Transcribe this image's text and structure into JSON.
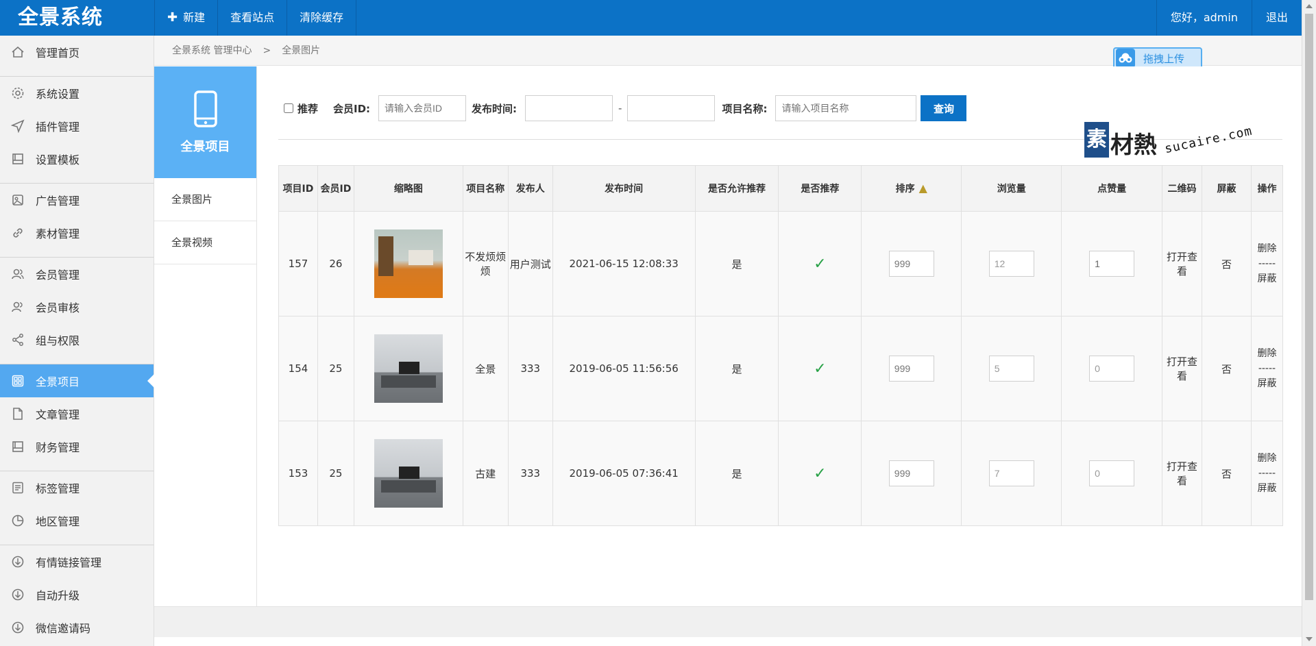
{
  "app": {
    "brand": "全景系统"
  },
  "topnav": {
    "new_label": "新建",
    "view_site_label": "查看站点",
    "clear_cache_label": "清除缓存"
  },
  "user": {
    "greeting": "您好，admin",
    "logout_label": "退出"
  },
  "sidebar": {
    "items": [
      {
        "label": "管理首页",
        "icon": "home-icon"
      },
      {
        "label": "系统设置",
        "icon": "gear-icon"
      },
      {
        "label": "插件管理",
        "icon": "send-icon"
      },
      {
        "label": "设置模板",
        "icon": "template-icon"
      },
      {
        "label": "广告管理",
        "icon": "image-icon"
      },
      {
        "label": "素材管理",
        "icon": "link-icon"
      },
      {
        "label": "会员管理",
        "icon": "users-icon"
      },
      {
        "label": "会员审核",
        "icon": "user-check-icon"
      },
      {
        "label": "组与权限",
        "icon": "share-icon"
      },
      {
        "label": "全景项目",
        "icon": "grid-icon"
      },
      {
        "label": "文章管理",
        "icon": "file-icon"
      },
      {
        "label": "财务管理",
        "icon": "book-icon"
      },
      {
        "label": "标签管理",
        "icon": "list-icon"
      },
      {
        "label": "地区管理",
        "icon": "pie-icon"
      },
      {
        "label": "有情链接管理",
        "icon": "download-circle-icon"
      },
      {
        "label": "自动升级",
        "icon": "download-circle-icon"
      },
      {
        "label": "微信邀请码",
        "icon": "download-circle-icon"
      }
    ]
  },
  "breadcrumb": {
    "root": "全景系统 管理中心",
    "separator": ">",
    "current": "全景图片"
  },
  "upload": {
    "label": "拖拽上传"
  },
  "subnav": {
    "title": "全景项目",
    "items": [
      "全景图片",
      "全景视频"
    ]
  },
  "filters": {
    "recommend_label": "推荐",
    "member_id_label": "会员ID:",
    "member_id_placeholder": "请输入会员ID",
    "publish_time_label": "发布时间:",
    "range_separator": "-",
    "project_name_label": "项目名称:",
    "project_name_placeholder": "请输入项目名称",
    "query_label": "查询"
  },
  "watermark": {
    "logo_char": "素",
    "text": "材熱",
    "url": "sucaire.com"
  },
  "table": {
    "headers": {
      "project_id": "项目ID",
      "member_id": "会员ID",
      "thumbnail": "缩略图",
      "project_name": "项目名称",
      "publisher": "发布人",
      "publish_time": "发布时间",
      "allow_recommend": "是否允许推荐",
      "is_recommended": "是否推荐",
      "sort": "排序",
      "views": "浏览量",
      "likes": "点赞量",
      "qrcode": "二维码",
      "block": "屏蔽",
      "actions": "操作"
    },
    "rows": [
      {
        "id": "157",
        "member_id": "26",
        "name": "不发烦烦烦",
        "publisher": "用户测试",
        "time": "2021-06-15 12:08:33",
        "allow": "是",
        "recommended": "✓",
        "sort_placeholder": "999",
        "views": "12",
        "likes": "1",
        "qrcode": "打开查看",
        "blocked": "否",
        "delete": "删除",
        "divider": "-----",
        "block_action": "屏蔽"
      },
      {
        "id": "154",
        "member_id": "25",
        "name": "全景",
        "publisher": "333",
        "time": "2019-06-05 11:56:56",
        "allow": "是",
        "recommended": "✓",
        "sort_placeholder": "999",
        "views": "5",
        "likes": "0",
        "qrcode": "打开查看",
        "blocked": "否",
        "delete": "删除",
        "divider": "-----",
        "block_action": "屏蔽"
      },
      {
        "id": "153",
        "member_id": "25",
        "name": "古建",
        "publisher": "333",
        "time": "2019-06-05 07:36:41",
        "allow": "是",
        "recommended": "✓",
        "sort_placeholder": "999",
        "views": "7",
        "likes": "0",
        "qrcode": "打开查看",
        "blocked": "否",
        "delete": "删除",
        "divider": "-----",
        "block_action": "屏蔽"
      }
    ]
  },
  "colors": {
    "primary": "#0c72c6",
    "sidebar_active": "#53a8f0",
    "subnav_head": "#5bb1f5",
    "check": "#27a146"
  }
}
